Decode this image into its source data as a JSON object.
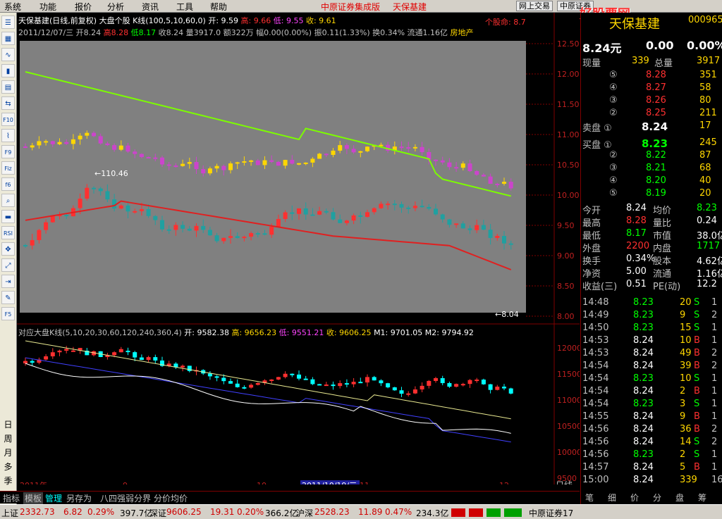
{
  "menu": {
    "items": [
      "系统",
      "功能",
      "报价",
      "分析",
      "资讯",
      "工具",
      "帮助"
    ],
    "app_name": "中原证券集成版",
    "stock_name": "天保基建",
    "btn_trade": "网上交易",
    "btn_center": "中原证券",
    "watermark": "好股票网Goodgupiao.com",
    "watermark_sub": "股票软件公式"
  },
  "toolbar": {
    "period_labels": [
      "日",
      "周",
      "月",
      "多",
      "季"
    ],
    "icons": [
      "list-icon",
      "grid-icon",
      "line-icon",
      "candle-icon",
      "table-icon",
      "flow-icon",
      "f10-icon",
      "trend-icon",
      "f9-icon",
      "fiz-icon",
      "f6-icon",
      "search-icon",
      "vol-icon",
      "rsi-icon",
      "move-icon",
      "zoom-icon",
      "exit-icon",
      "pen-icon",
      "f5-icon"
    ]
  },
  "main_chart": {
    "title_line": "天保基建(日线,前复权) 大盘个股 K线(100,5,10,60,0)",
    "open_label": "开: 9.59",
    "high_label": "高: 9.66",
    "low_label": "低: 9.55",
    "close_label": "收: 9.61",
    "info_line": "2011/12/07/三 开8.24",
    "info_high": "高8.28",
    "info_low": "低8.17",
    "info_rest": "收8.24 量3917.0 额322万 幅0.00(0.00%) 振0.11(1.33%) 换0.34% 流通1.16亿",
    "info_sector": "房地产",
    "alert": "个股命: 8.7",
    "max_label": "110.46",
    "min_label": "8.04",
    "y_ticks": [
      "12.50",
      "12.00",
      "11.50",
      "11.00",
      "10.50",
      "10.00",
      "9.50",
      "9.00",
      "8.50",
      "8.00"
    ]
  },
  "index_chart": {
    "title_line": "对应大盘K线(5,10,20,30,60,120,240,360,4)",
    "open_label": "开: 9582.38",
    "high_label": "高: 9656.23",
    "low_label": "低: 9551.21",
    "close_label": "收: 9606.25",
    "m1": "M1: 9701.05",
    "m2": "M2: 9794.92",
    "y_ticks": [
      "12000",
      "11500",
      "11000",
      "10500",
      "10000",
      "9500"
    ],
    "x_labels": [
      "2011年",
      "9",
      "10",
      "2011/10/19/三",
      "11",
      "12"
    ],
    "period": "日线"
  },
  "bottom_tabs": [
    "指标",
    "模板",
    "管理",
    "另存为",
    "八四强弱分界",
    "分价均价"
  ],
  "quote": {
    "name": "天保基建",
    "code": "000965",
    "price": "8.24元",
    "chg": "0.00",
    "pct": "0.00%",
    "now_vol_label": "现量",
    "now_vol": "339",
    "total_vol_label": "总量",
    "total_vol": "3917",
    "asks": [
      {
        "lvl": "⑤",
        "price": "8.28",
        "vol": "351"
      },
      {
        "lvl": "④",
        "price": "8.27",
        "vol": "58"
      },
      {
        "lvl": "③",
        "price": "8.26",
        "vol": "80"
      },
      {
        "lvl": "②",
        "price": "8.25",
        "vol": "211"
      },
      {
        "lvl": "卖盘 ①",
        "price": "8.24",
        "vol": "17"
      }
    ],
    "bids": [
      {
        "lvl": "买盘 ①",
        "price": "8.23",
        "vol": "245"
      },
      {
        "lvl": "②",
        "price": "8.22",
        "vol": "87"
      },
      {
        "lvl": "③",
        "price": "8.21",
        "vol": "68"
      },
      {
        "lvl": "④",
        "price": "8.20",
        "vol": "40"
      },
      {
        "lvl": "⑤",
        "price": "8.19",
        "vol": "20"
      }
    ],
    "stats": [
      {
        "k1": "今开",
        "v1": "8.24",
        "k2": "均价",
        "v2": "8.23",
        "c1": "#fff",
        "c2": "#00ff00"
      },
      {
        "k1": "最高",
        "v1": "8.28",
        "k2": "量比",
        "v2": "0.24",
        "c1": "#ff3030",
        "c2": "#fff"
      },
      {
        "k1": "最低",
        "v1": "8.17",
        "k2": "市值",
        "v2": "38.0亿",
        "c1": "#00ff00",
        "c2": "#fff"
      },
      {
        "k1": "外盘",
        "v1": "2200",
        "k2": "内盘",
        "v2": "1717",
        "c1": "#ff3030",
        "c2": "#00ff00"
      },
      {
        "k1": "换手",
        "v1": "0.34%",
        "k2": "股本",
        "v2": "4.62亿",
        "c1": "#fff",
        "c2": "#fff"
      },
      {
        "k1": "净资",
        "v1": "5.00",
        "k2": "流通",
        "v2": "1.16亿",
        "c1": "#fff",
        "c2": "#fff"
      },
      {
        "k1": "收益(三)",
        "v1": "0.51",
        "k2": "PE(动)",
        "v2": "12.2",
        "c1": "#fff",
        "c2": "#fff"
      }
    ],
    "ticks": [
      {
        "t": "14:48",
        "p": "8.23",
        "v": "20",
        "s": "S",
        "n": "1"
      },
      {
        "t": "14:49",
        "p": "8.23",
        "v": "9",
        "s": "S",
        "n": "2"
      },
      {
        "t": "14:50",
        "p": "8.23",
        "v": "15",
        "s": "S",
        "n": "1"
      },
      {
        "t": "14:53",
        "p": "8.24",
        "v": "10",
        "s": "B",
        "n": "1"
      },
      {
        "t": "14:53",
        "p": "8.24",
        "v": "49",
        "s": "B",
        "n": "2"
      },
      {
        "t": "14:54",
        "p": "8.24",
        "v": "39",
        "s": "B",
        "n": "2"
      },
      {
        "t": "14:54",
        "p": "8.23",
        "v": "10",
        "s": "S",
        "n": "1"
      },
      {
        "t": "14:54",
        "p": "8.24",
        "v": "2",
        "s": "B",
        "n": "1"
      },
      {
        "t": "14:54",
        "p": "8.23",
        "v": "3",
        "s": "S",
        "n": "1"
      },
      {
        "t": "14:55",
        "p": "8.24",
        "v": "9",
        "s": "B",
        "n": "1"
      },
      {
        "t": "14:56",
        "p": "8.24",
        "v": "36",
        "s": "B",
        "n": "2"
      },
      {
        "t": "14:56",
        "p": "8.24",
        "v": "14",
        "s": "S",
        "n": "2"
      },
      {
        "t": "14:56",
        "p": "8.23",
        "v": "2",
        "s": "S",
        "n": "1"
      },
      {
        "t": "14:57",
        "p": "8.24",
        "v": "5",
        "s": "B",
        "n": "1"
      },
      {
        "t": "15:00",
        "p": "8.24",
        "v": "339",
        "s": "",
        "n": "16"
      }
    ],
    "bottom_tabs": [
      "笔",
      "细",
      "价",
      "分",
      "盘",
      "筹"
    ]
  },
  "status": {
    "sh_label": "上证",
    "sh_val": "2332.73",
    "sh_chg": "6.82",
    "sh_pct": "0.29%",
    "sh_amt": "397.7亿",
    "sz_label": "深证",
    "sz_val": "9606.25",
    "sz_chg": "19.31",
    "sz_pct": "0.20%",
    "sz_amt": "366.2亿",
    "hs_label": "沪深",
    "hs_val": "2528.23",
    "hs_chg": "11.89",
    "hs_pct": "0.47%",
    "hs_amt": "234.3亿",
    "broker": "中原证券17"
  },
  "colors": {
    "up": "#ff3030",
    "down": "#00ffff",
    "ma_green": "#7cfc00",
    "ma_red": "#e02020",
    "panel": "#808080",
    "magenta": "#cc44cc",
    "yellow": "#ffd700"
  }
}
